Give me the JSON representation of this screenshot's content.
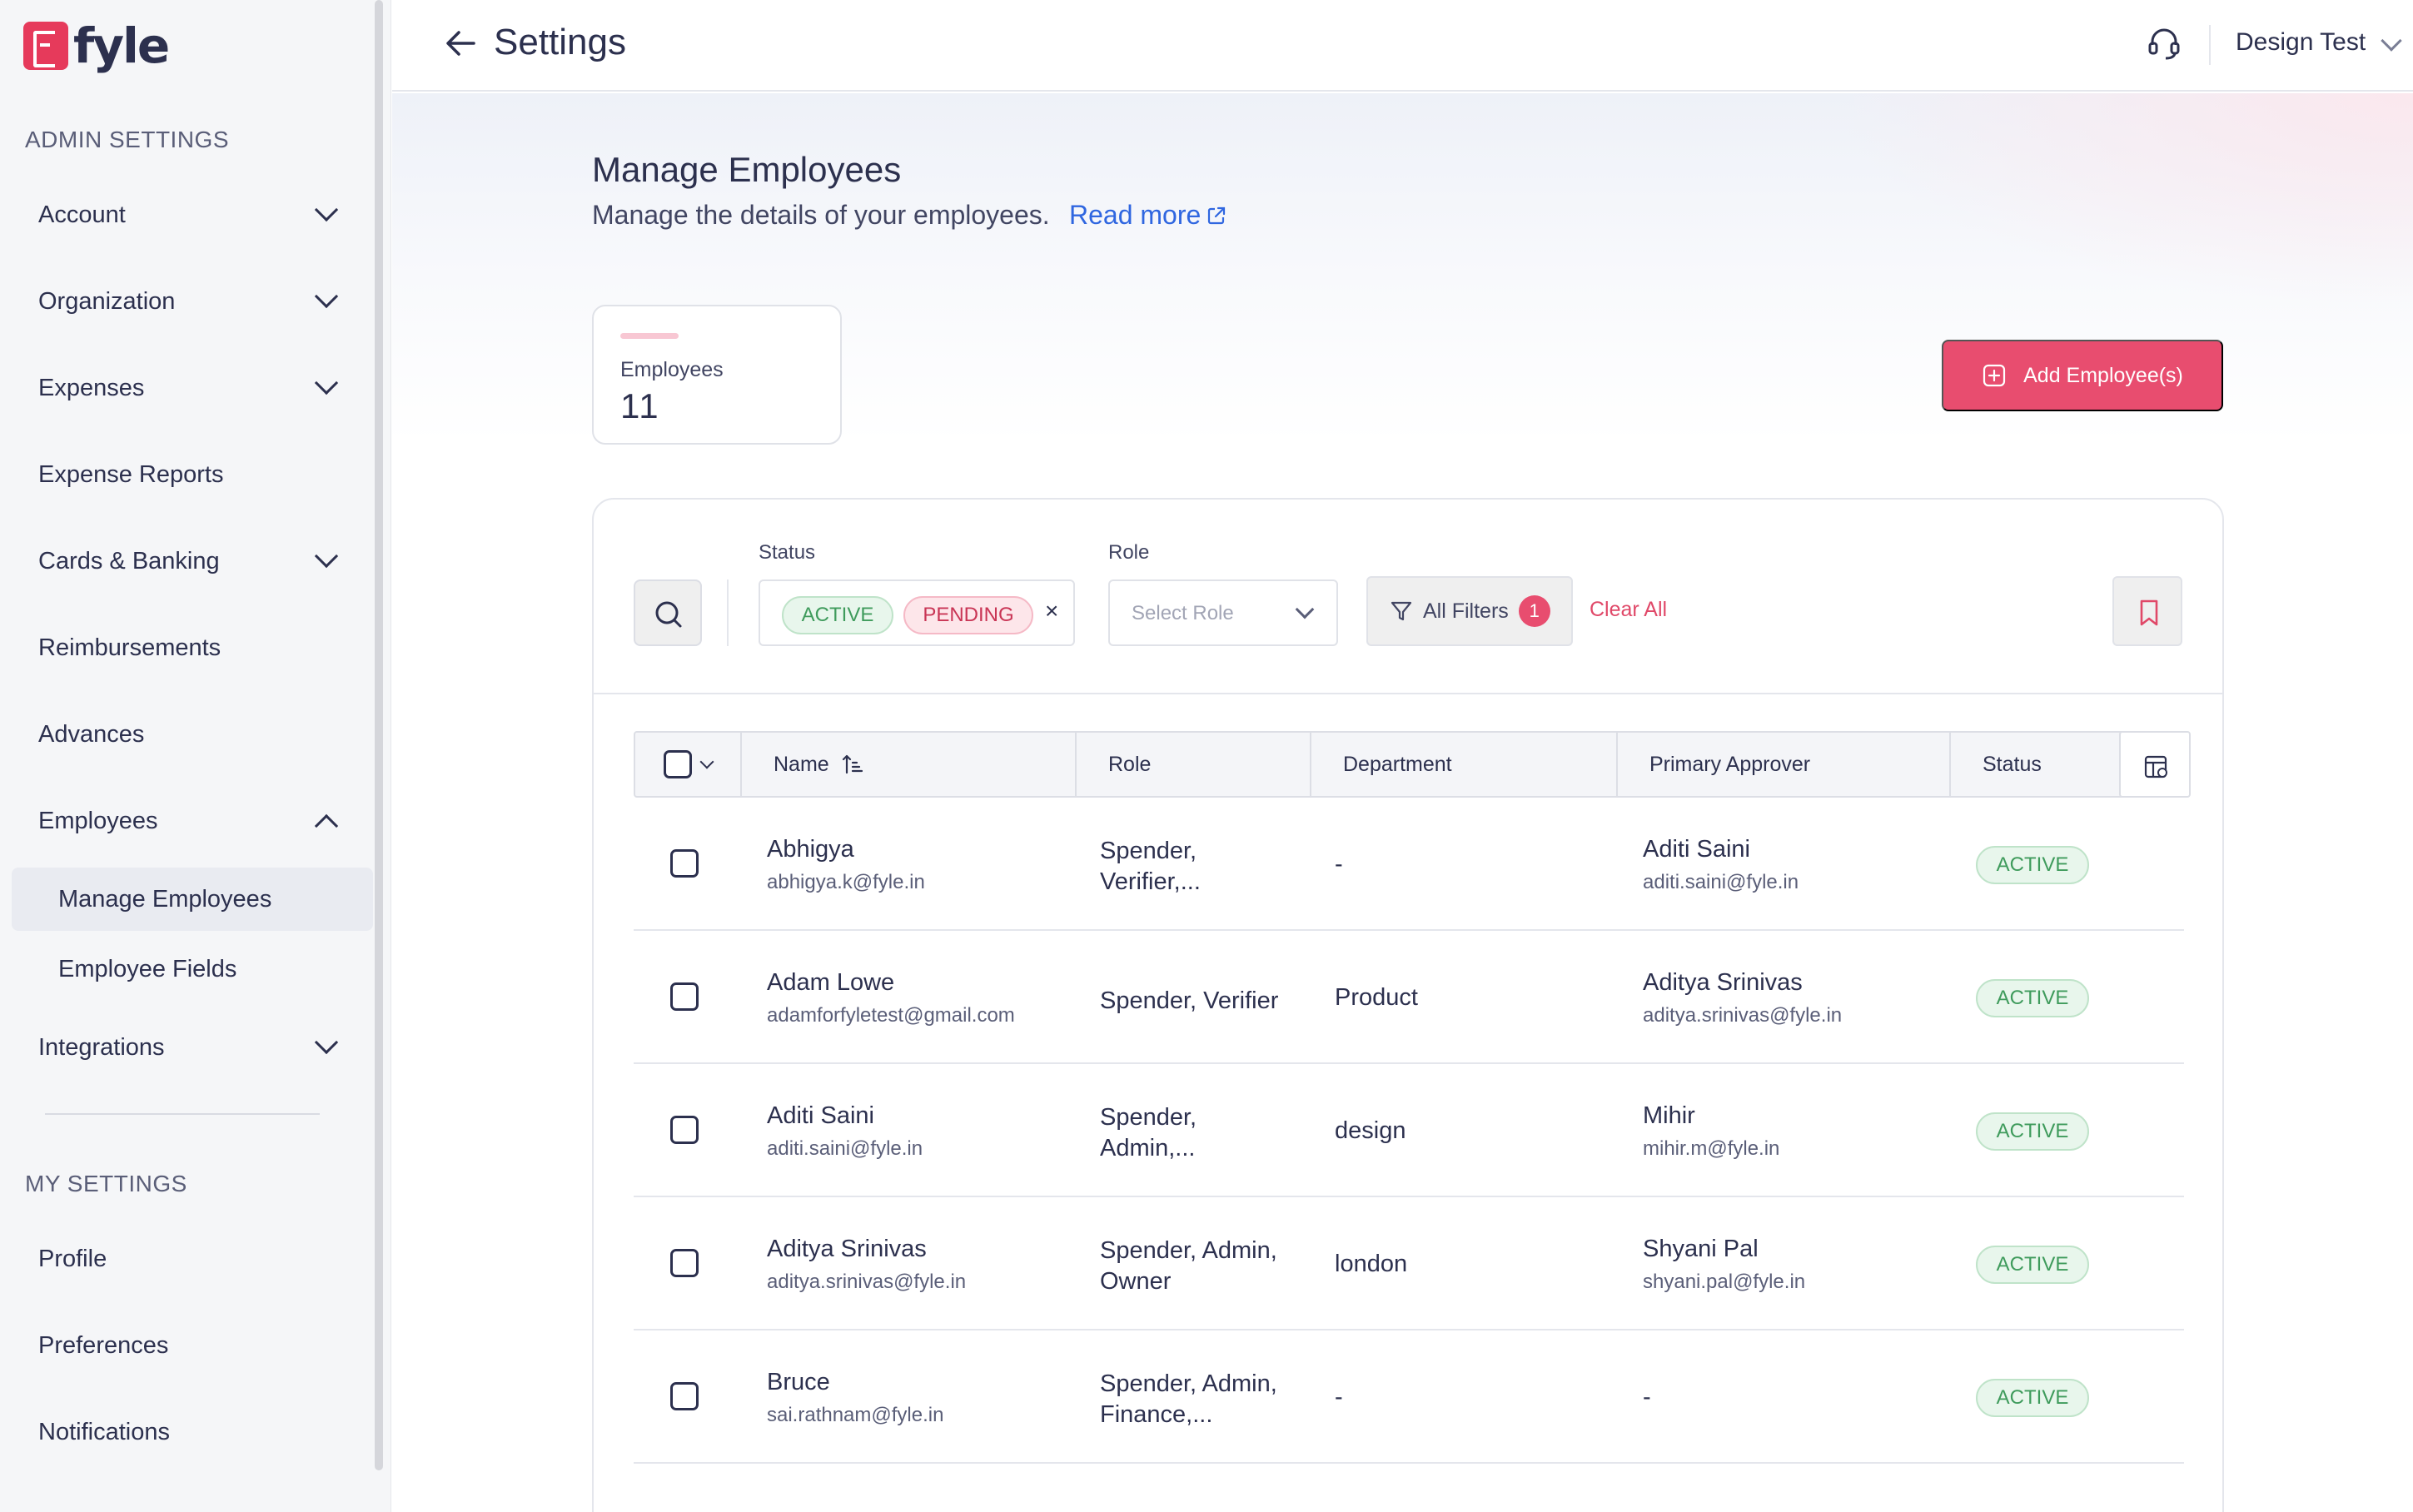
{
  "brand": {
    "name": "fyle"
  },
  "sidebar": {
    "admin_section": "ADMIN SETTINGS",
    "items": [
      {
        "label": "Account",
        "expandable": true
      },
      {
        "label": "Organization",
        "expandable": true
      },
      {
        "label": "Expenses",
        "expandable": true
      },
      {
        "label": "Expense Reports",
        "expandable": false
      },
      {
        "label": "Cards & Banking",
        "expandable": true
      },
      {
        "label": "Reimbursements",
        "expandable": false
      },
      {
        "label": "Advances",
        "expandable": false
      },
      {
        "label": "Employees",
        "expandable": true,
        "expanded": true
      },
      {
        "label": "Integrations",
        "expandable": true
      }
    ],
    "employees_sub": [
      {
        "label": "Manage Employees",
        "active": true
      },
      {
        "label": "Employee Fields",
        "active": false
      }
    ],
    "my_section": "MY SETTINGS",
    "my_items": [
      {
        "label": "Profile"
      },
      {
        "label": "Preferences"
      },
      {
        "label": "Notifications"
      }
    ]
  },
  "header": {
    "title": "Settings",
    "org_name": "Design Test"
  },
  "page": {
    "title": "Manage Employees",
    "description": "Manage the details of your employees.",
    "read_more": "Read more",
    "stat": {
      "label": "Employees",
      "value": "11"
    },
    "add_button": "Add Employee(s)"
  },
  "filters": {
    "status_label": "Status",
    "status_chips": [
      "ACTIVE",
      "PENDING"
    ],
    "role_label": "Role",
    "role_placeholder": "Select Role",
    "all_filters": "All Filters",
    "all_filters_count": "1",
    "clear_all": "Clear All"
  },
  "table": {
    "columns": [
      "Name",
      "Role",
      "Department",
      "Primary Approver",
      "Status"
    ],
    "rows": [
      {
        "name": "Abhigya",
        "email": "abhigya.k@fyle.in",
        "role_line1": "Spender,",
        "role_line2": "Verifier,...",
        "department": "-",
        "approver": "Aditi Saini",
        "approver_email": "aditi.saini@fyle.in",
        "status": "ACTIVE"
      },
      {
        "name": "Adam Lowe",
        "email": "adamforfyletest@gmail.com",
        "role_line1": "Spender, Verifier",
        "role_line2": "",
        "department": "Product",
        "approver": "Aditya Srinivas",
        "approver_email": "aditya.srinivas@fyle.in",
        "status": "ACTIVE"
      },
      {
        "name": "Aditi Saini",
        "email": "aditi.saini@fyle.in",
        "role_line1": "Spender,",
        "role_line2": "Admin,...",
        "department": "design",
        "approver": "Mihir",
        "approver_email": "mihir.m@fyle.in",
        "status": "ACTIVE"
      },
      {
        "name": "Aditya Srinivas",
        "email": "aditya.srinivas@fyle.in",
        "role_line1": "Spender, Admin,",
        "role_line2": "Owner",
        "department": "london",
        "approver": "Shyani Pal",
        "approver_email": "shyani.pal@fyle.in",
        "status": "ACTIVE"
      },
      {
        "name": "Bruce",
        "email": "sai.rathnam@fyle.in",
        "role_line1": "Spender, Admin,",
        "role_line2": "Finance,...",
        "department": "-",
        "approver": "-",
        "approver_email": "",
        "status": "ACTIVE"
      }
    ]
  },
  "colors": {
    "brand": "#e63a5b",
    "primary_button": "#e84d6f",
    "link": "#2f66e0",
    "active_green": "#3f9b5c",
    "pending_red": "#c93555"
  }
}
